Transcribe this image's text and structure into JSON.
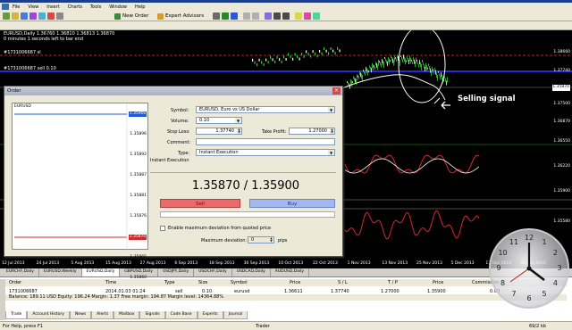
{
  "menu": [
    "File",
    "View",
    "Insert",
    "Charts",
    "Tools",
    "Window",
    "Help"
  ],
  "toolbar": {
    "new_order": "New Order",
    "expert_advisors": "Expert Advisors"
  },
  "chart": {
    "title": "EURUSD,Daily 1.36760 1.36810 1.36813 1.36870",
    "subtitle": "0 minutes 1 seconds left to bar end",
    "sl_label": "#1731006687 sl",
    "tp_label": "#1731006687 sell 0.10",
    "selling_signal": "Selling signal",
    "price_tag_ask": "1.35870",
    "price_tag_bid": "1.35900",
    "right_prices": [
      "1.38660",
      "1.37740",
      "1.37500",
      "1.36870",
      "1.36550",
      "1.36220",
      "1.35900",
      "1.35580"
    ],
    "dates": [
      "12 Jul 2013",
      "24 Jul 2013",
      "5 Aug 2013",
      "15 Aug 2013",
      "27 Aug 2013",
      "6 Sep 2013",
      "18 Sep 2013",
      "30 Sep 2013",
      "10 Oct 2013",
      "22 Oct 2013",
      "1 Nov 2013",
      "13 Nov 2013",
      "25 Nov 2013",
      "5 Dec 2013",
      "17 Dec 2013",
      "30 Dec 2013"
    ],
    "tabs": [
      "EURCHF,Daily",
      "EURUSD,Weekly",
      "EURUSD,Daily",
      "GBPUSD,Daily",
      "USDJPY,Daily",
      "USDCHF,Daily",
      "USDCAD,Daily",
      "AUDUSD,Daily"
    ],
    "active_tab": "EURUSD,Daily"
  },
  "order": {
    "title": "Order",
    "tick_symbol": "EURUSD",
    "tick_prices": [
      "1.35900",
      "1.35896",
      "1.35892",
      "1.35887",
      "1.35881",
      "1.35876",
      "1.35870",
      "1.35865",
      "1.35860"
    ],
    "symbol_label": "Symbol:",
    "symbol_value": "EURUSD, Euro vs US Dollar",
    "volume_label": "Volume:",
    "volume_value": "0.10",
    "stoploss_label": "Stop Loss:",
    "stoploss_value": "1.37740",
    "takeprofit_label": "Take Profit:",
    "takeprofit_value": "1.27000",
    "comment_label": "Comment:",
    "comment_value": "",
    "type_label": "Type:",
    "type_value": "Instant Execution",
    "section_label": "Instant Execution",
    "quote": "1.35870 / 1.35900",
    "sell_label": "Sell",
    "buy_label": "Buy",
    "deviation_check_label": "Enable maximum deviation from quoted price",
    "max_deviation_label": "Maximum deviation:",
    "max_deviation_value": "0",
    "pips_label": "pips"
  },
  "terminal": {
    "headers": [
      "Order",
      "Time",
      "Type",
      "Size",
      "Symbol",
      "Price",
      "S / L",
      "T / P",
      "Price",
      "Commission"
    ],
    "row": [
      "1731006687",
      "2014.01.03 01:24",
      "sell",
      "0.10",
      "eurusd",
      "1.36611",
      "1.37740",
      "1.27000",
      "1.35900",
      "0.00"
    ],
    "balance": "Balance: 189.11 USD  Equity: 196.24  Margin: 1.37  Free margin: 194.87  Margin level: 14364.88%",
    "tabs": [
      "Trade",
      "Account History",
      "News",
      "Alerts",
      "Mailbox",
      "Signals",
      "Code Base",
      "Experts",
      "Journal"
    ]
  },
  "status": {
    "help": "For Help, press F1",
    "profile": "Trader",
    "traffic": "69/2 kb"
  },
  "clock": {
    "numbers": [
      "12",
      "1",
      "2",
      "3",
      "4",
      "5",
      "6",
      "7",
      "8",
      "9",
      "10",
      "11"
    ]
  },
  "colors": {
    "buy": "#a3b8ef",
    "sell": "#e86a6a",
    "sl_line": "#d42a2a",
    "tp_line": "#2a2ad4",
    "ma_line": "#ffffff"
  }
}
